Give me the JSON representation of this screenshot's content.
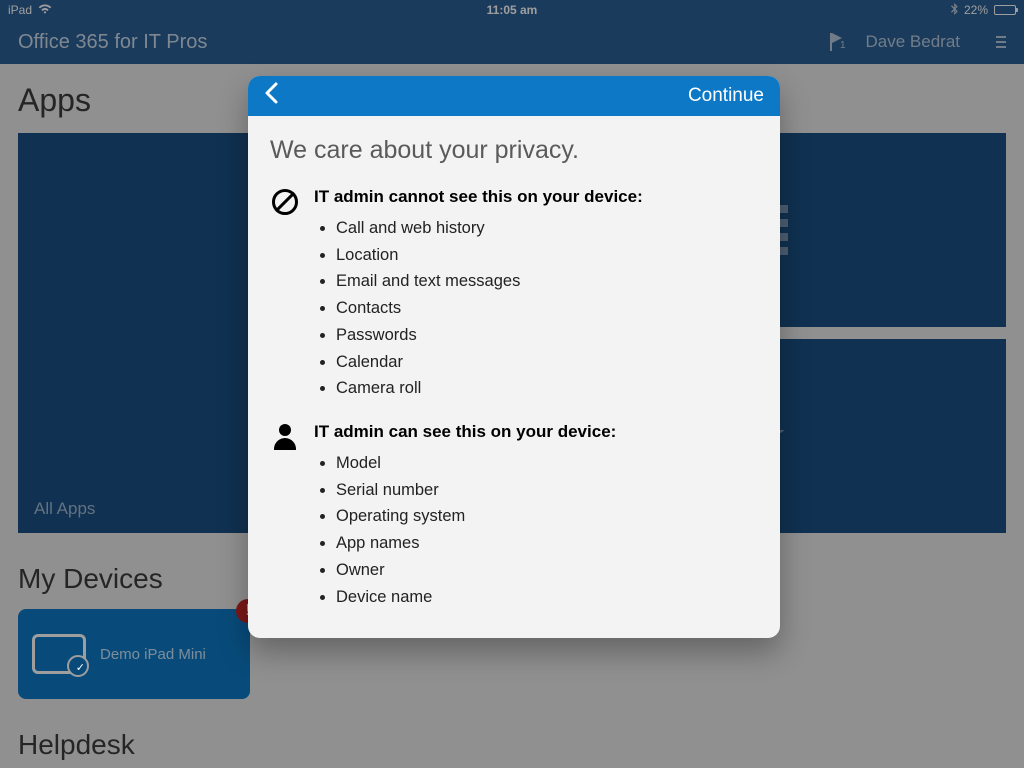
{
  "status": {
    "device": "iPad",
    "time": "11:05 am",
    "battery_pct": "22%",
    "battery_fill": 22
  },
  "header": {
    "title": "Office 365 for IT Pros",
    "flag_count": "1",
    "user_name": "Dave Bedrat"
  },
  "sections": {
    "apps_heading": "Apps",
    "all_apps_label": "All Apps",
    "my_devices_heading": "My Devices",
    "helpdesk_heading": "Helpdesk"
  },
  "device_card": {
    "name": "Demo iPad Mini",
    "alert": "!"
  },
  "modal": {
    "continue": "Continue",
    "title": "We care about your privacy.",
    "cannot": {
      "heading": "IT admin cannot see this on your device:",
      "items": [
        "Call and web history",
        "Location",
        "Email and text messages",
        "Contacts",
        "Passwords",
        "Calendar",
        "Camera roll"
      ]
    },
    "can": {
      "heading": "IT admin can see this on your device:",
      "items": [
        "Model",
        "Serial number",
        "Operating system",
        "App names",
        "Owner",
        "Device name"
      ]
    }
  }
}
